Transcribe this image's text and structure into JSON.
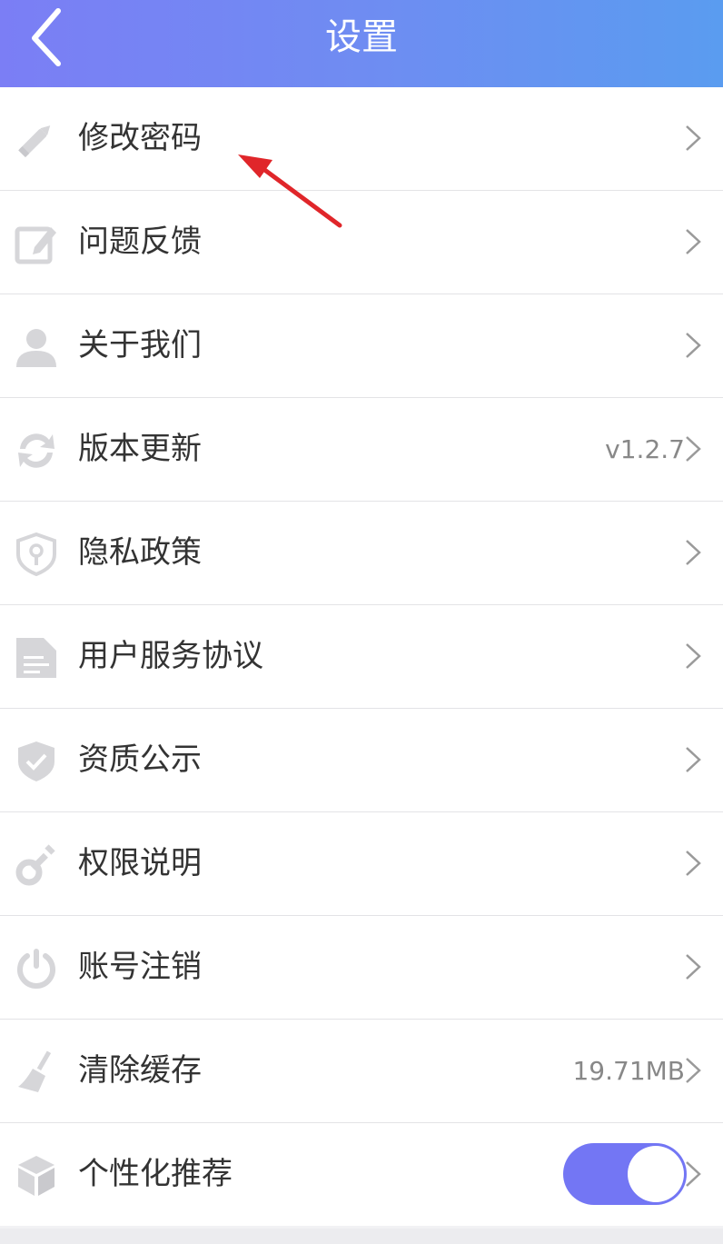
{
  "header": {
    "title": "设置"
  },
  "icon_color": "#d6d6d9",
  "accent_color": "#7376f4",
  "annotation_color": "#e0262a",
  "rows": [
    {
      "label": "修改密码",
      "icon": "pencil-icon",
      "value": ""
    },
    {
      "label": "问题反馈",
      "icon": "edit-note-icon",
      "value": ""
    },
    {
      "label": "关于我们",
      "icon": "user-icon",
      "value": ""
    },
    {
      "label": "版本更新",
      "icon": "refresh-icon",
      "value": "v1.2.7"
    },
    {
      "label": "隐私政策",
      "icon": "shield-lock-icon",
      "value": ""
    },
    {
      "label": "用户服务协议",
      "icon": "document-icon",
      "value": ""
    },
    {
      "label": "资质公示",
      "icon": "shield-check-icon",
      "value": ""
    },
    {
      "label": "权限说明",
      "icon": "key-icon",
      "value": ""
    },
    {
      "label": "账号注销",
      "icon": "power-icon",
      "value": ""
    },
    {
      "label": "清除缓存",
      "icon": "broom-icon",
      "value": "19.71MB"
    },
    {
      "label": "个性化推荐",
      "icon": "cube-icon",
      "value": "",
      "toggle": true,
      "toggle_on": true
    }
  ]
}
